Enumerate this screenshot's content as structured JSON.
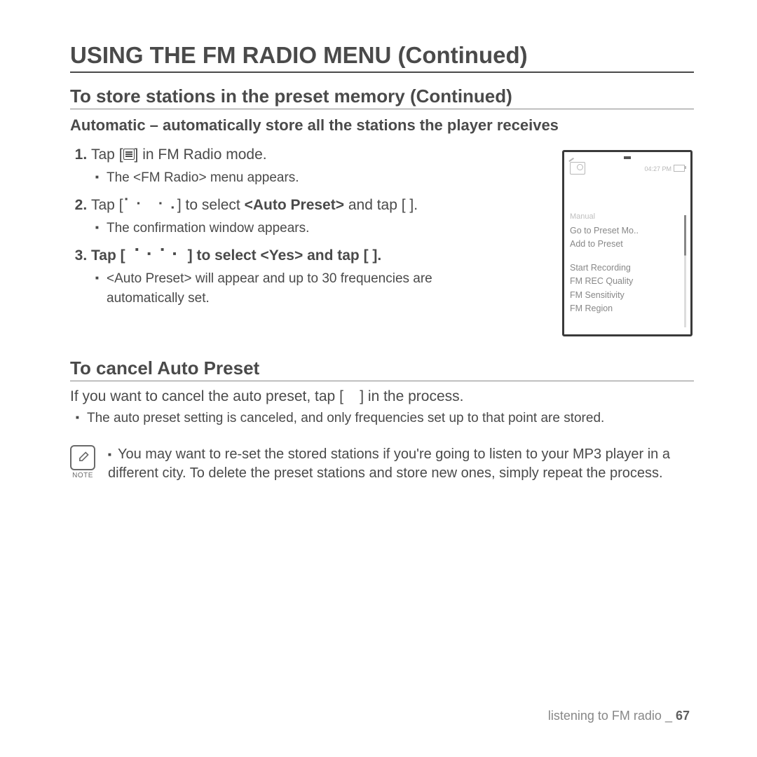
{
  "heading": "USING THE FM RADIO MENU (Continued)",
  "sub1": "To store stations in the preset memory (Continued)",
  "sub1b": "Automatic – automatically store all the stations the player receives",
  "step1_a": "Tap [",
  "step1_b": "] in FM Radio mode.",
  "step1_sub": "The <FM Radio> menu appears.",
  "step2_a": "Tap [",
  "step2_b": "] to select ",
  "step2_bold": "<Auto Preset>",
  "step2_c": " and tap [    ].",
  "step2_sub": "The confirmation window appears.",
  "step3_a": "Tap [ ",
  "step3_b": " ] to select ",
  "step3_bold": "<Yes>",
  "step3_c": " and tap [     ].",
  "step3_sub": "<Auto Preset> will appear and up to 30 frequencies are automatically set.",
  "sub2": "To cancel Auto Preset",
  "cancel_body_a": "If you want to cancel the auto preset, tap [",
  "cancel_body_b": "] in the process.",
  "cancel_sub": "The auto preset setting is canceled, and only frequencies set up to that point are stored.",
  "note_label": "NOTE",
  "note_text": "You may want to re-set the stored stations if you're going to listen to your MP3 player in a different city. To delete the preset stations and store new ones, simply repeat the process.",
  "device": {
    "time": "04:27 PM",
    "manual": "Manual",
    "items1": [
      "Go to Preset Mo..",
      "Add to Preset"
    ],
    "items2": [
      "Start Recording",
      "FM REC Quality",
      "FM Sensitivity",
      "FM Region"
    ]
  },
  "footer_text": "listening to FM radio _ ",
  "footer_page": "67"
}
